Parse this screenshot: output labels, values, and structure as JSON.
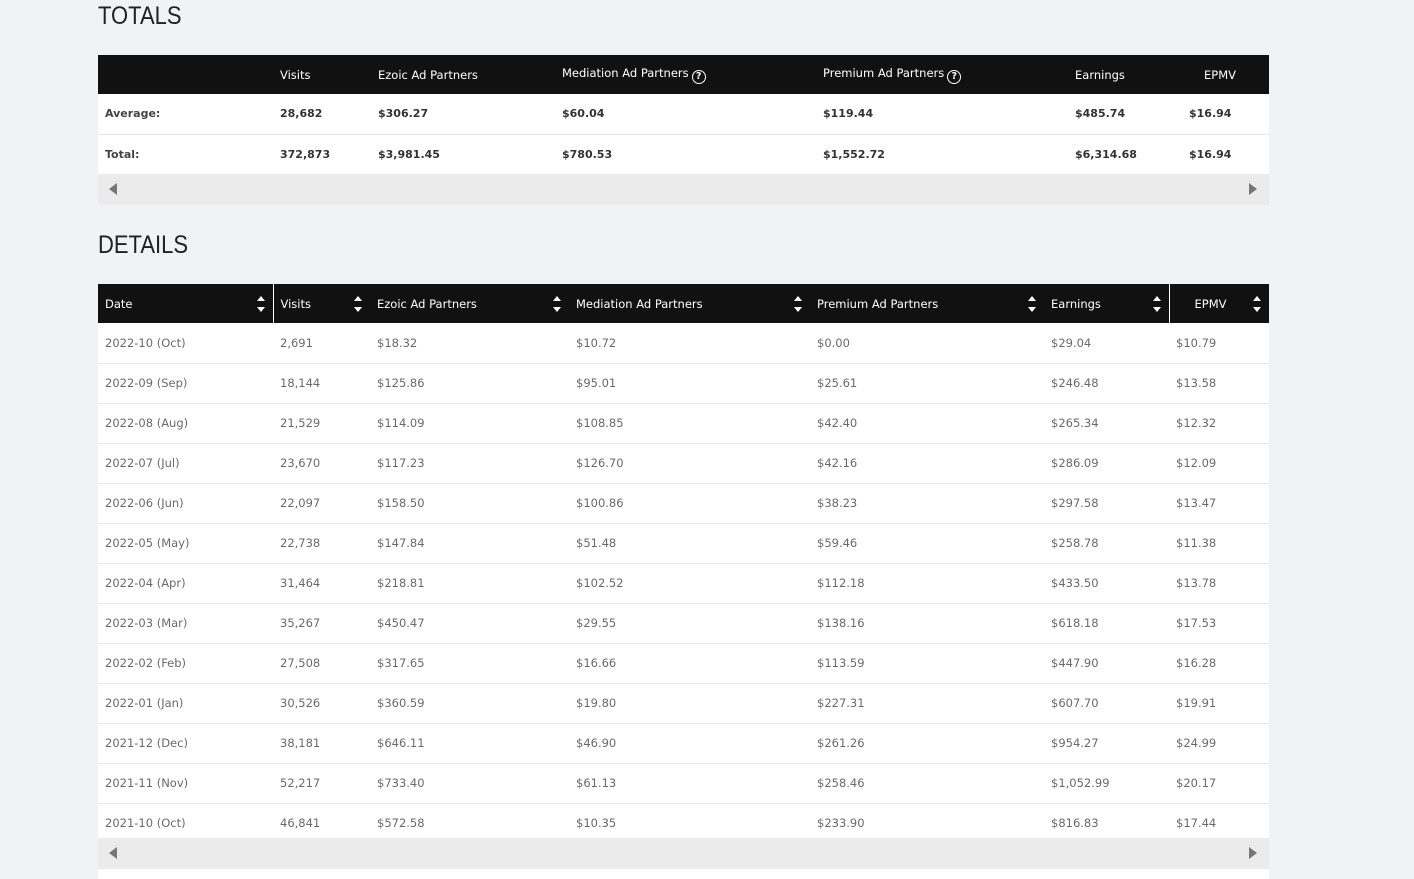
{
  "totals": {
    "title": "TOTALS",
    "headers": [
      "",
      "Visits",
      "Ezoic Ad Partners",
      "Mediation Ad Partners",
      "Premium Ad Partners",
      "Earnings",
      "EPMV"
    ],
    "rows": [
      [
        "Average:",
        "28,682",
        "$306.27",
        "$60.04",
        "$119.44",
        "$485.74",
        "$16.94"
      ],
      [
        "Total:",
        "372,873",
        "$3,981.45",
        "$780.53",
        "$1,552.72",
        "$6,314.68",
        "$16.94"
      ]
    ]
  },
  "details": {
    "title": "DETAILS",
    "headers": [
      "Date",
      "Visits",
      "Ezoic Ad Partners",
      "Mediation Ad Partners",
      "Premium Ad Partners",
      "Earnings",
      "EPMV"
    ],
    "rows": [
      [
        "2022-10 (Oct)",
        "2,691",
        "$18.32",
        "$10.72",
        "$0.00",
        "$29.04",
        "$10.79"
      ],
      [
        "2022-09 (Sep)",
        "18,144",
        "$125.86",
        "$95.01",
        "$25.61",
        "$246.48",
        "$13.58"
      ],
      [
        "2022-08 (Aug)",
        "21,529",
        "$114.09",
        "$108.85",
        "$42.40",
        "$265.34",
        "$12.32"
      ],
      [
        "2022-07 (Jul)",
        "23,670",
        "$117.23",
        "$126.70",
        "$42.16",
        "$286.09",
        "$12.09"
      ],
      [
        "2022-06 (Jun)",
        "22,097",
        "$158.50",
        "$100.86",
        "$38.23",
        "$297.58",
        "$13.47"
      ],
      [
        "2022-05 (May)",
        "22,738",
        "$147.84",
        "$51.48",
        "$59.46",
        "$258.78",
        "$11.38"
      ],
      [
        "2022-04 (Apr)",
        "31,464",
        "$218.81",
        "$102.52",
        "$112.18",
        "$433.50",
        "$13.78"
      ],
      [
        "2022-03 (Mar)",
        "35,267",
        "$450.47",
        "$29.55",
        "$138.16",
        "$618.18",
        "$17.53"
      ],
      [
        "2022-02 (Feb)",
        "27,508",
        "$317.65",
        "$16.66",
        "$113.59",
        "$447.90",
        "$16.28"
      ],
      [
        "2022-01 (Jan)",
        "30,526",
        "$360.59",
        "$19.80",
        "$227.31",
        "$607.70",
        "$19.91"
      ],
      [
        "2021-12 (Dec)",
        "38,181",
        "$646.11",
        "$46.90",
        "$261.26",
        "$954.27",
        "$24.99"
      ],
      [
        "2021-11 (Nov)",
        "52,217",
        "$733.40",
        "$61.13",
        "$258.46",
        "$1,052.99",
        "$20.17"
      ],
      [
        "2021-10 (Oct)",
        "46,841",
        "$572.58",
        "$10.35",
        "$233.90",
        "$816.83",
        "$17.44"
      ]
    ]
  },
  "icons": {
    "help": "question-circle-icon",
    "sort": "sort-icon",
    "scroll_left": "arrow-left-icon",
    "scroll_right": "arrow-right-icon"
  },
  "colors": {
    "header_bg": "#111111",
    "page_bg": "#f1f2f4",
    "scrollbar_bg": "#ebebeb"
  }
}
